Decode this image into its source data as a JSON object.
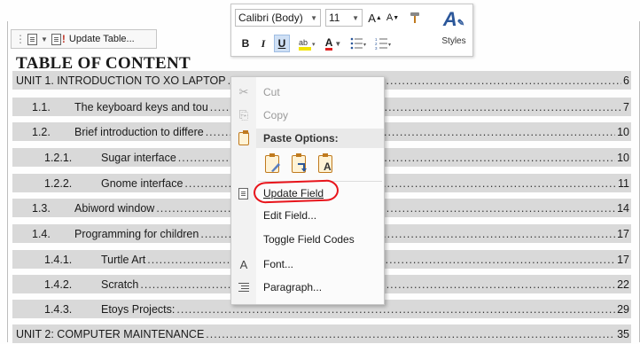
{
  "field_toolbar": {
    "update_label": "Update Table..."
  },
  "doc": {
    "toc_title": "TABLE OF CONTENT",
    "rows": [
      {
        "num": "",
        "text": "UNIT 1. INTRODUCTION TO XO LAPTOP",
        "page": "6"
      },
      {
        "num": "1.1.",
        "text": "The keyboard keys and tou",
        "page": "7"
      },
      {
        "num": "1.2.",
        "text": "Brief introduction to differe",
        "page": "10"
      },
      {
        "num": "1.2.1.",
        "text": "Sugar interface",
        "page": "10"
      },
      {
        "num": "1.2.2.",
        "text": "Gnome interface",
        "page": "11"
      },
      {
        "num": "1.3.",
        "text": "Abiword window",
        "page": "14"
      },
      {
        "num": "1.4.",
        "text": "Programming for children",
        "page": "17"
      },
      {
        "num": "1.4.1.",
        "text": "Turtle Art",
        "page": "17"
      },
      {
        "num": "1.4.2.",
        "text": "Scratch",
        "page": "22"
      },
      {
        "num": "1.4.3.",
        "text": "Etoys Projects:",
        "page": "29"
      },
      {
        "num": "",
        "text": "UNIT 2: COMPUTER MAINTENANCE",
        "page": "35"
      }
    ]
  },
  "mini_toolbar": {
    "font": "Calibri (Body)",
    "size": "11",
    "grow": "A",
    "shrink": "A",
    "bold": "B",
    "italic": "I",
    "underline": "U",
    "font_color": "A",
    "styles_label": "Styles"
  },
  "context_menu": {
    "cut": "Cut",
    "copy": "Copy",
    "paste_header": "Paste Options:",
    "update_field": "Update Field",
    "edit_field": "Edit Field...",
    "toggle_codes": "Toggle Field Codes",
    "font": "Font...",
    "paragraph": "Paragraph..."
  },
  "colors": {
    "field_shade": "#d9d9d9",
    "highlight_ring": "#e8141b",
    "accent": "#2b579a"
  }
}
